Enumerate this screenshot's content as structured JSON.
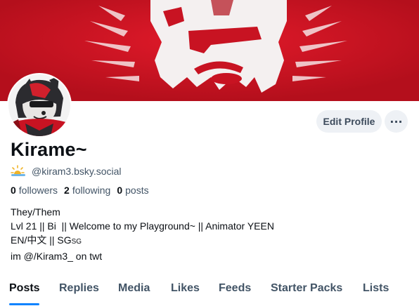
{
  "profile": {
    "display_name": "Kirame~",
    "handle": "@kiram3.bsky.social",
    "stats": {
      "followers_count": "0",
      "followers_label": "followers",
      "following_count": "2",
      "following_label": "following",
      "posts_count": "0",
      "posts_label": "posts"
    },
    "bio": {
      "line1": "They/Them",
      "line2": "Lvl 21 || Bi  || Welcome to my Playground~ || Animator YEEN",
      "line3_main": "EN/中文 || SG",
      "line3_small": "SG",
      "line4": "im @/Kiram3_ on twt"
    }
  },
  "actions": {
    "edit_label": "Edit Profile",
    "more_label": "···"
  },
  "tabs": [
    {
      "label": "Posts",
      "active": true
    },
    {
      "label": "Replies"
    },
    {
      "label": "Media"
    },
    {
      "label": "Likes"
    },
    {
      "label": "Feeds"
    },
    {
      "label": "Starter Packs"
    },
    {
      "label": "Lists"
    }
  ],
  "colors": {
    "banner_red": "#c81322",
    "accent_blue": "#1083fe"
  },
  "icons": {
    "handle_badge": "sun-cloud-icon",
    "more": "ellipsis-icon"
  }
}
